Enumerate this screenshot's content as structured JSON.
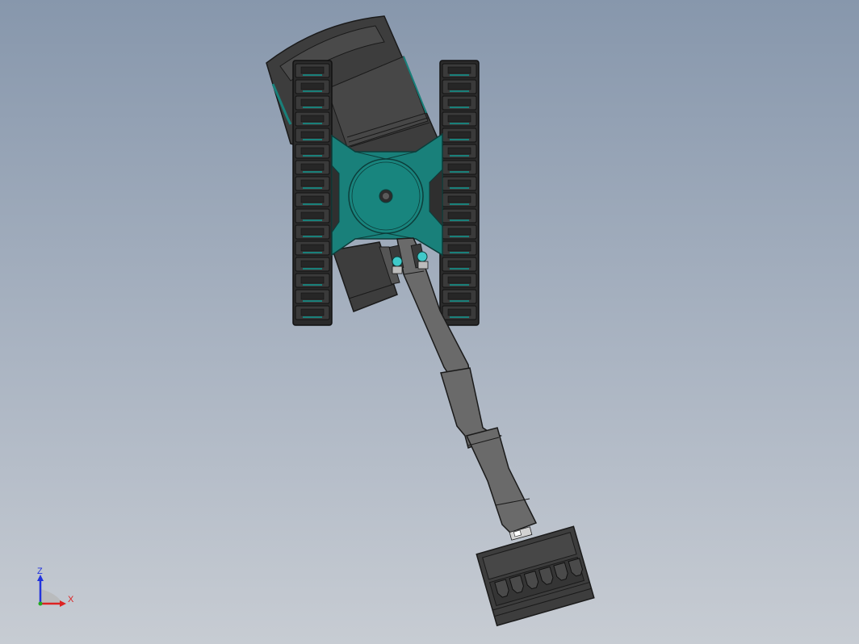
{
  "viewport": {
    "background_top": "#8797ac",
    "background_bottom": "#c7ccd3"
  },
  "model": {
    "type": "crawler excavator (top view, 3D CAD)",
    "colors": {
      "body": "#3d3d3d",
      "body_edge": "#1a1a1a",
      "teal": "#19807a",
      "teal_light": "#3fc9c9",
      "arm": "#6a6a6a",
      "track": "#2f2f2f"
    }
  },
  "axes_triad": {
    "z_label": "Z",
    "x_label": "X",
    "z_color": "#2233dd",
    "x_color": "#dd2222"
  }
}
